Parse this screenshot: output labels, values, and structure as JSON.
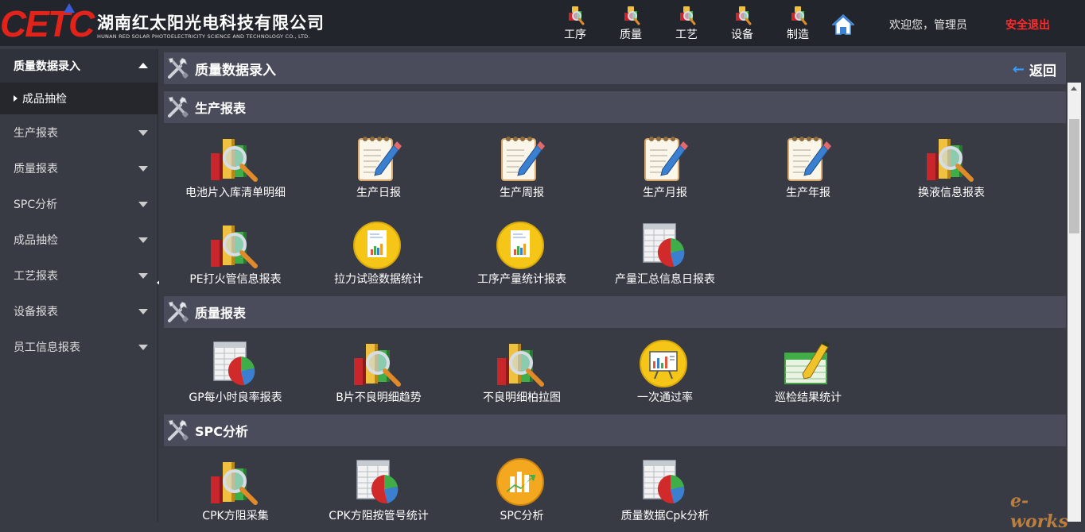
{
  "header": {
    "logo_text": "CETC",
    "company_cn": "湖南红太阳光电科技有限公司",
    "company_en": "HUNAN RED SOLAR PHOTOELECTRICITY SCIENCE AND TECHNOLOGY CO., LTD.",
    "nav": [
      {
        "label": "工序",
        "icon": "robot-icon"
      },
      {
        "label": "质量",
        "icon": "robot-icon"
      },
      {
        "label": "工艺",
        "icon": "robot-icon"
      },
      {
        "label": "设备",
        "icon": "robot-icon"
      },
      {
        "label": "制造",
        "icon": "robot-icon"
      }
    ],
    "home_icon": "home-icon",
    "welcome": "欢迎您，管理员",
    "logout": "安全退出"
  },
  "sidebar": {
    "active_group": "质量数据录入",
    "active_sub": "成品抽检",
    "items": [
      {
        "label": "生产报表"
      },
      {
        "label": "质量报表"
      },
      {
        "label": "SPC分析"
      },
      {
        "label": "成品抽检"
      },
      {
        "label": "工艺报表"
      },
      {
        "label": "设备报表"
      },
      {
        "label": "员工信息报表"
      }
    ]
  },
  "main": {
    "title": "质量数据录入",
    "back_label": "返回",
    "sections": [
      {
        "title": "生产报表",
        "tiles": [
          {
            "label": "电池片入库清单明细",
            "icon": "bar-chart-magnifier-icon"
          },
          {
            "label": "生产日报",
            "icon": "notepad-pencil-icon"
          },
          {
            "label": "生产周报",
            "icon": "notepad-pencil-icon"
          },
          {
            "label": "生产月报",
            "icon": "notepad-pencil-icon"
          },
          {
            "label": "生产年报",
            "icon": "notepad-pencil-icon"
          },
          {
            "label": "换液信息报表",
            "icon": "bar-chart-magnifier-icon"
          },
          {
            "label": "PE打火管信息报表",
            "icon": "bar-chart-magnifier-icon"
          },
          {
            "label": "拉力试验数据统计",
            "icon": "yellow-report-icon"
          },
          {
            "label": "工序产量统计报表",
            "icon": "yellow-report-icon"
          },
          {
            "label": "产量汇总信息日报表",
            "icon": "spreadsheet-pie-icon"
          }
        ]
      },
      {
        "title": "质量报表",
        "tiles": [
          {
            "label": "GP每小时良率报表",
            "icon": "spreadsheet-pie-icon"
          },
          {
            "label": "B片不良明细趋势",
            "icon": "bar-chart-magnifier-icon"
          },
          {
            "label": "不良明细柏拉图",
            "icon": "bar-chart-magnifier-icon"
          },
          {
            "label": "一次通过率",
            "icon": "presentation-board-icon"
          },
          {
            "label": "巡检结果统计",
            "icon": "green-ledger-pen-icon"
          }
        ]
      },
      {
        "title": "SPC分析",
        "tiles": [
          {
            "label": "CPK方阻采集",
            "icon": "bar-chart-magnifier-icon"
          },
          {
            "label": "CPK方阻按管号统计",
            "icon": "spreadsheet-pie-icon"
          },
          {
            "label": "SPC分析",
            "icon": "orange-growth-chart-icon"
          },
          {
            "label": "质量数据Cpk分析",
            "icon": "spreadsheet-pie-icon"
          }
        ]
      }
    ]
  },
  "watermark": "e-works",
  "colors": {
    "logo_red": "#e2231a",
    "logout_red": "#ff2a2a",
    "back_arrow": "#3a9bff",
    "topbar_bg": "#23252c",
    "content_bg": "#383a44",
    "section_bg": "#4a4c5b"
  }
}
